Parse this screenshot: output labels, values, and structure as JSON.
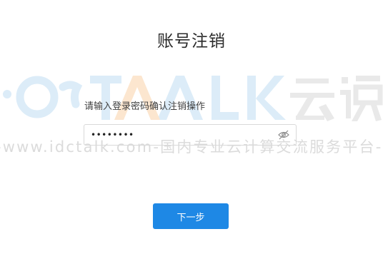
{
  "page": {
    "title": "账号注销"
  },
  "form": {
    "instruction": "请输入登录密码确认注销操作",
    "password_masked": "••••••••",
    "eye_icon": "eye-hidden-icon"
  },
  "actions": {
    "next_label": "下一步"
  },
  "watermark": {
    "brand": "TALK 云说",
    "url_text": "-www.idctalk.com-国内专业云计算交流服务平台-"
  },
  "colors": {
    "primary": "#1e88e5",
    "watermark_blue": "#d6e9f8",
    "watermark_orange": "#fbe3c8",
    "watermark_gray": "#e6e6e6"
  }
}
